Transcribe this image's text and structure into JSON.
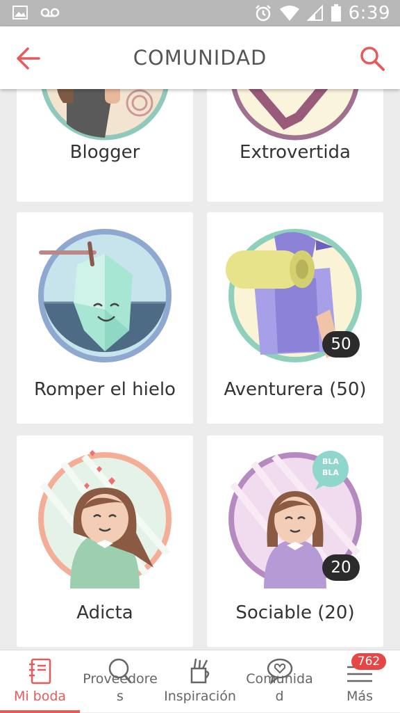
{
  "status_bar": {
    "time": "6:39"
  },
  "app_bar": {
    "title": "COMUNIDAD"
  },
  "badges": [
    {
      "label": "Blogger"
    },
    {
      "label": "Extrovertida"
    },
    {
      "label": "Romper el hielo"
    },
    {
      "label": "Aventurera (50)",
      "count": "50"
    },
    {
      "label": "Adicta"
    },
    {
      "label": "Sociable (20)",
      "count": "20",
      "bubble": "BLA BLA"
    }
  ],
  "bottom_nav": {
    "items": [
      {
        "label": "Mi boda"
      },
      {
        "label_line1": "Proveedore",
        "label_line2": "s"
      },
      {
        "label": "Inspiración"
      },
      {
        "label_line1": "Comunida",
        "label_line2": "d"
      },
      {
        "label": "Más"
      }
    ],
    "notification_count": "762"
  },
  "colors": {
    "accent": "#e85a5a",
    "status_bar": "#b8b8b8"
  }
}
